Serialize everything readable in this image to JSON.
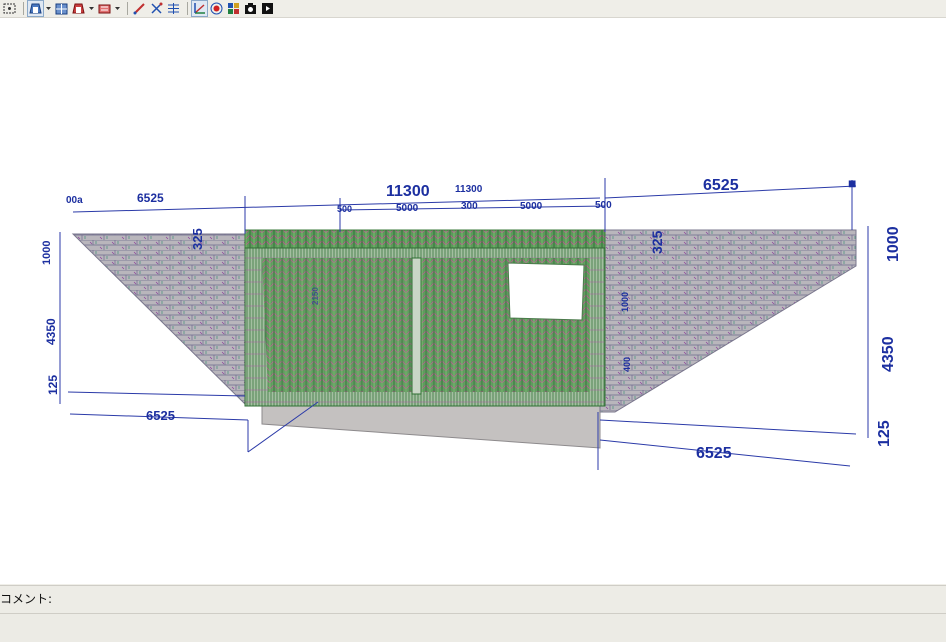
{
  "toolbar": {
    "buttons": [
      {
        "name": "select-icon",
        "color": "#333333"
      },
      {
        "name": "view-3d-icon",
        "color": "#1a4fa0",
        "dropdown": true
      },
      {
        "name": "view-plan-icon",
        "color": "#1a4fa0"
      },
      {
        "name": "view-front-icon",
        "color": "#c03030",
        "dropdown": true
      },
      {
        "name": "view-side-icon",
        "color": "#c03030",
        "dropdown": true
      },
      {
        "name": "measure-icon",
        "color": "#c03030"
      },
      {
        "name": "dimension-icon",
        "color": "#2050b0"
      },
      {
        "name": "grid-lines-icon",
        "color": "#2050b0"
      },
      {
        "name": "axis-icon",
        "color": "#c03030"
      },
      {
        "name": "target-icon",
        "color": "#d02020"
      },
      {
        "name": "palette-icon",
        "color": "#208040"
      },
      {
        "name": "camera-icon",
        "color": "#111111"
      },
      {
        "name": "play-icon",
        "color": "#111111"
      }
    ]
  },
  "drawing": {
    "top_total": "11300",
    "top_total_small": "11300",
    "top_left_wing": "6525",
    "top_right_wing": "6525",
    "left_edge_label": "00a",
    "top_parts": [
      "500",
      "5000",
      "300",
      "5000",
      "500"
    ],
    "left_heights": [
      "1000",
      "4350",
      "125"
    ],
    "right_heights": [
      "1000",
      "4350",
      "125"
    ],
    "slab_left": "325",
    "slab_right": "325",
    "bottom_left_wing": "6525",
    "bottom_right_wing": "6525",
    "inner_labels": [
      "2150",
      "1000",
      "400"
    ],
    "marker": "■"
  },
  "comment": {
    "label": "コメント:",
    "value": ""
  }
}
